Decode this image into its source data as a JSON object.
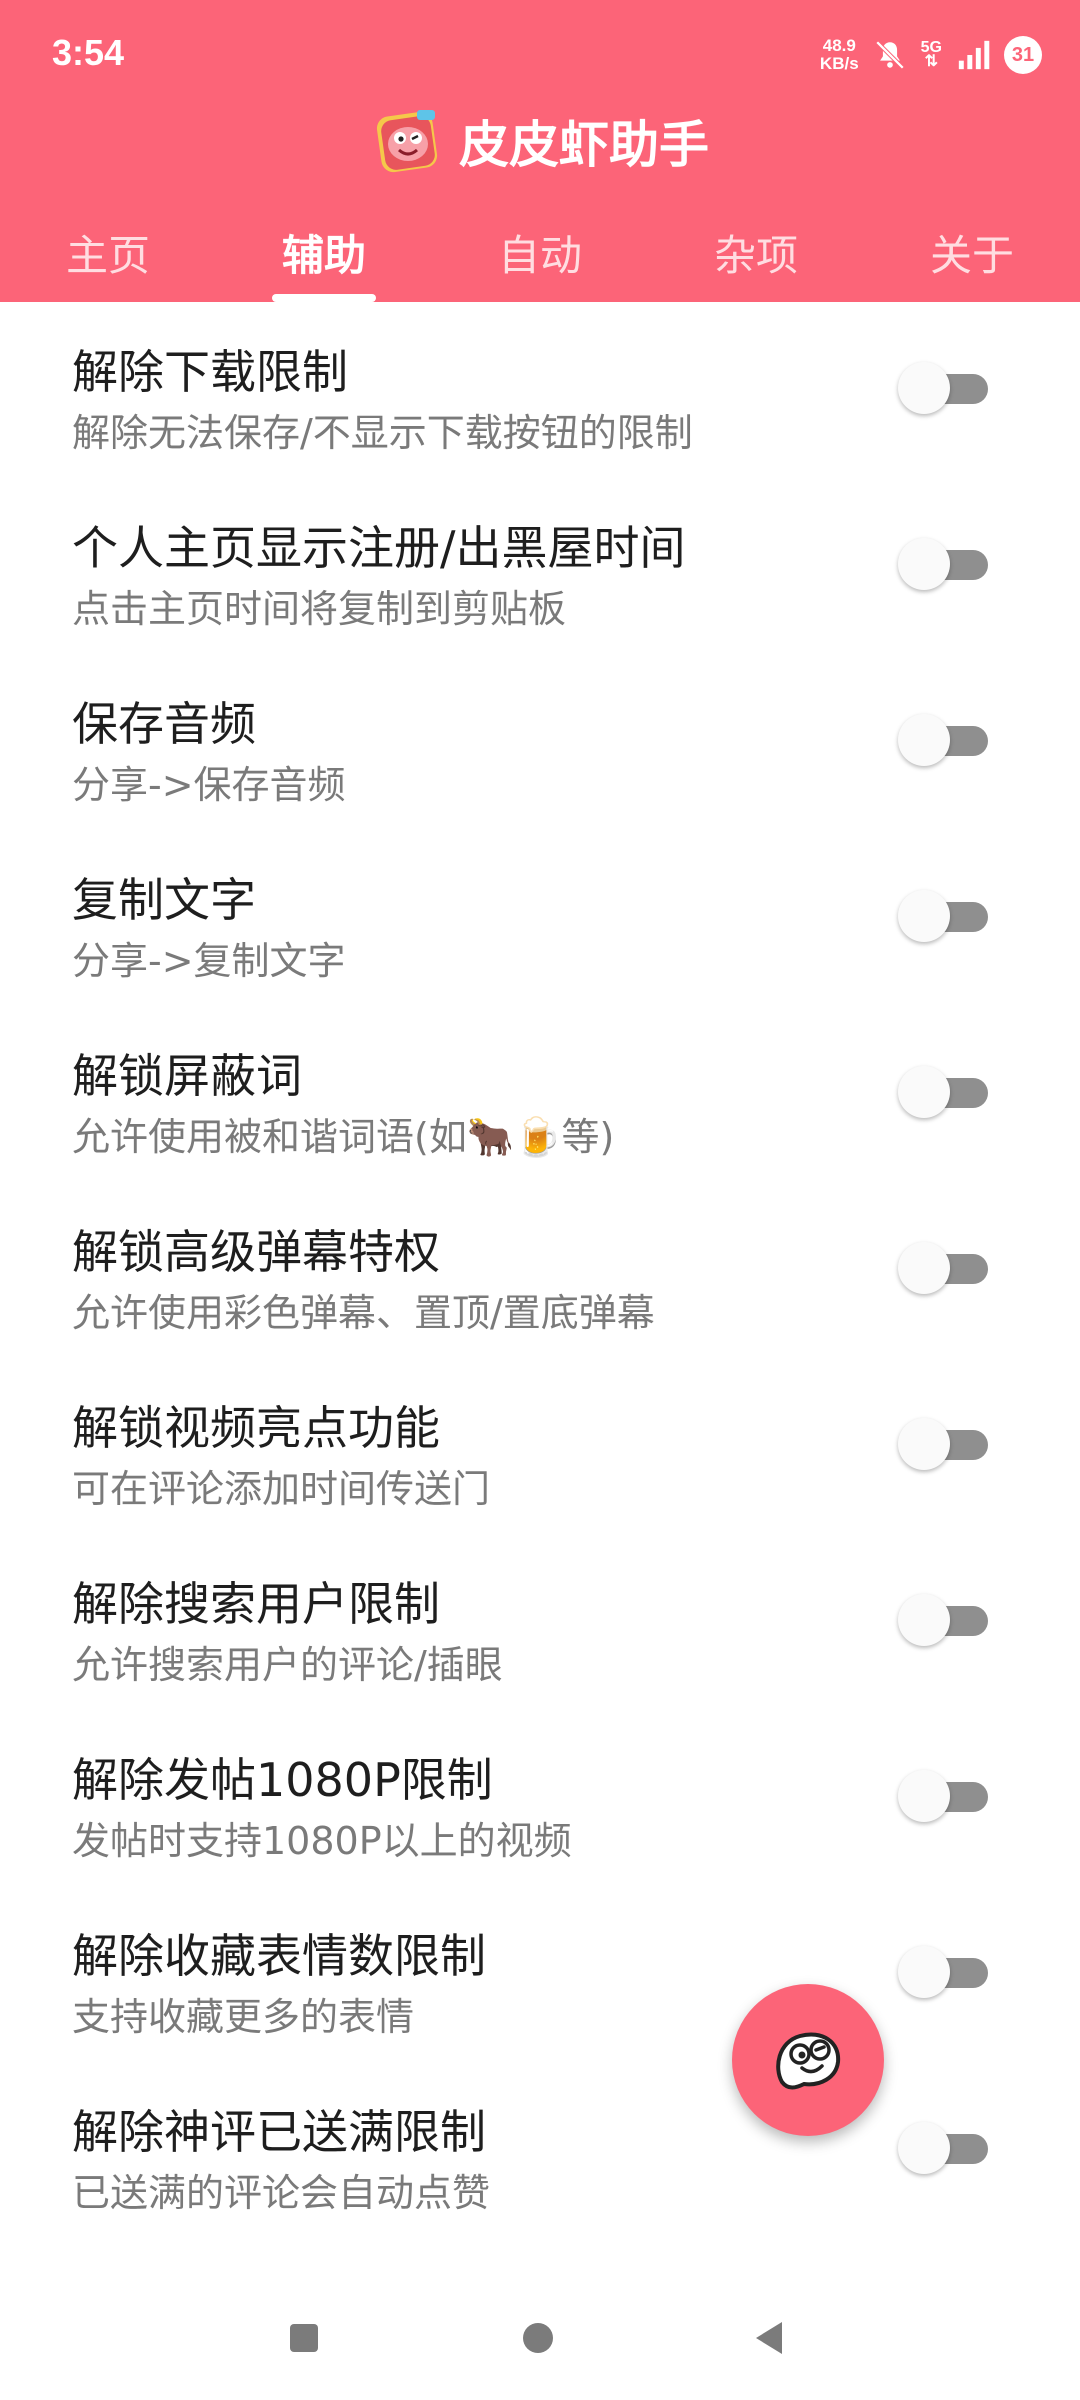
{
  "status_bar": {
    "time": "3:54",
    "net_speed_value": "48.9",
    "net_speed_unit": "KB/s",
    "network": "5G",
    "battery": "31"
  },
  "app": {
    "title": "皮皮虾助手",
    "accent_color": "#fc6478"
  },
  "tabs": [
    {
      "label": "主页",
      "active": false
    },
    {
      "label": "辅助",
      "active": true
    },
    {
      "label": "自动",
      "active": false
    },
    {
      "label": "杂项",
      "active": false
    },
    {
      "label": "关于",
      "active": false
    }
  ],
  "settings": [
    {
      "title": "解除下载限制",
      "subtitle": "解除无法保存/不显示下载按钮的限制",
      "enabled": false
    },
    {
      "title": "个人主页显示注册/出黑屋时间",
      "subtitle": "点击主页时间将复制到剪贴板",
      "enabled": false
    },
    {
      "title": "保存音频",
      "subtitle": "分享->保存音频",
      "enabled": false
    },
    {
      "title": "复制文字",
      "subtitle": "分享->复制文字",
      "enabled": false
    },
    {
      "title": "解锁屏蔽词",
      "subtitle": "允许使用被和谐词语(如🐂🍺等)",
      "enabled": false
    },
    {
      "title": "解锁高级弹幕特权",
      "subtitle": "允许使用彩色弹幕、置顶/置底弹幕",
      "enabled": false
    },
    {
      "title": "解锁视频亮点功能",
      "subtitle": "可在评论添加时间传送门",
      "enabled": false
    },
    {
      "title": "解除搜索用户限制",
      "subtitle": "允许搜索用户的评论/插眼",
      "enabled": false
    },
    {
      "title": "解除发帖1080P限制",
      "subtitle": "发帖时支持1080P以上的视频",
      "enabled": false
    },
    {
      "title": "解除收藏表情数限制",
      "subtitle": "支持收藏更多的表情",
      "enabled": false
    },
    {
      "title": "解除神评已送满限制",
      "subtitle": "已送满的评论会自动点赞",
      "enabled": false
    }
  ],
  "icons": {
    "app_logo": "shrimp-logo-icon",
    "fab": "shrimp-face-icon",
    "mute": "bell-off-icon",
    "signal": "signal-bars-icon"
  }
}
